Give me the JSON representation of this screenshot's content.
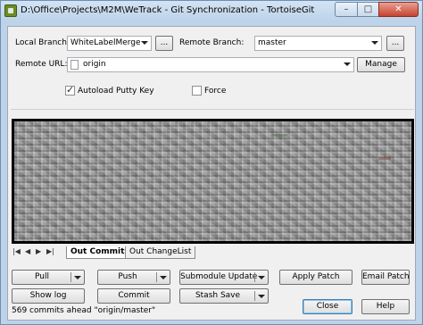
{
  "window": {
    "title": "D:\\Office\\Projects\\M2M\\WeTrack - Git Synchronization - TortoiseGit",
    "min_symbol": "–",
    "max_symbol": "□",
    "close_symbol": "✕"
  },
  "form": {
    "local_branch_label": "Local Branch:",
    "local_branch_value": "WhiteLabelMergeRe",
    "browse_label": "...",
    "remote_branch_label": "Remote Branch:",
    "remote_branch_value": "master",
    "remote_url_label": "Remote URL:",
    "remote_url_value": "origin",
    "manage_label": "Manage",
    "autoload_label": "Autoload Putty Key",
    "autoload_checked": true,
    "force_label": "Force",
    "force_checked": false
  },
  "tabs": {
    "items": [
      {
        "label": "Out Commits",
        "active": true
      },
      {
        "label": "Out ChangeList",
        "active": false
      }
    ]
  },
  "actions": {
    "pull": "Pull",
    "push": "Push",
    "submodule_update": "Submodule Update",
    "apply_patch": "Apply Patch",
    "email_patch": "Email Patch",
    "show_log": "Show log",
    "commit": "Commit",
    "stash_save": "Stash Save",
    "close": "Close",
    "help": "Help"
  },
  "status": {
    "text": "569 commits ahead \"origin/master\""
  }
}
